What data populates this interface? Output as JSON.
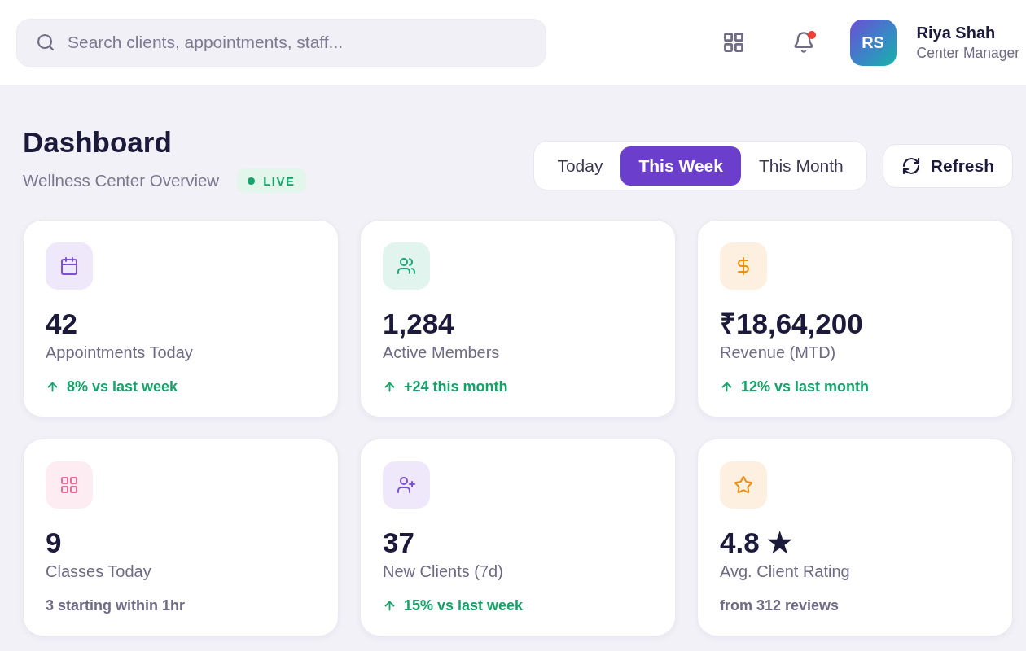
{
  "header": {
    "search": {
      "placeholder": "Search clients, appointments, staff..."
    },
    "notifications": {
      "unread": true
    },
    "user": {
      "initials": "RS",
      "name": "Riya Shah",
      "role": "Center Manager"
    }
  },
  "page": {
    "title": "Dashboard",
    "subtitle": "Wellness Center Overview",
    "status_badge": "LIVE"
  },
  "periods": [
    {
      "label": "Today",
      "selected": false
    },
    {
      "label": "This Week",
      "selected": true
    },
    {
      "label": "This Month",
      "selected": false
    }
  ],
  "refresh_button": "Refresh",
  "stats": [
    {
      "value": "42",
      "label": "Appointments Today",
      "note": "8% vs last week",
      "kind": "up",
      "color": "#7b4fd6"
    },
    {
      "value": "1,284",
      "label": "Active Members",
      "note": "+24 this month",
      "kind": "up",
      "color": "#1aa877"
    },
    {
      "value": "₹18,64,200",
      "label": "Revenue (MTD)",
      "note": "12% vs last month",
      "kind": "up",
      "color": "#ee8f10"
    },
    {
      "value": "9",
      "label": "Classes Today",
      "note": "3 starting within 1hr",
      "kind": "neutral",
      "color": "#ec6a95"
    },
    {
      "value": "37",
      "label": "New Clients (7d)",
      "note": "15% vs last week",
      "kind": "up",
      "color": "#7b4fd6"
    },
    {
      "value": "4.8 ★",
      "label": "Avg. Client Rating",
      "note": "from 312 reviews",
      "kind": "neutral",
      "color": "#ee8f10"
    }
  ]
}
